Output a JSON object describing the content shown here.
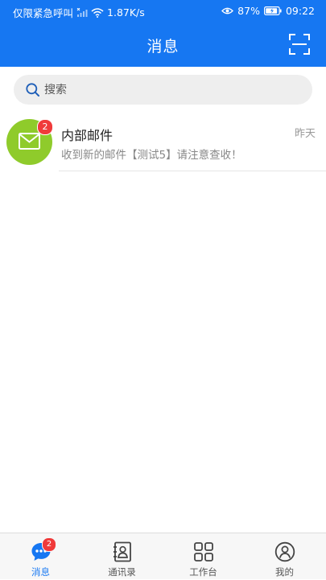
{
  "status_bar": {
    "carrier": "仅限紧急呼叫",
    "speed": "1.87K/s",
    "battery": "87%",
    "time": "09:22"
  },
  "header": {
    "title": "消息",
    "scan_icon": "scan-icon"
  },
  "search": {
    "placeholder": "搜索",
    "value": ""
  },
  "messages": [
    {
      "title": "内部邮件",
      "time": "昨天",
      "preview": "收到新的邮件【测试5】请注意查收！",
      "badge": "2",
      "icon": "mail-icon",
      "avatar_color": "#8fcb2b"
    }
  ],
  "tabs": [
    {
      "label": "消息",
      "icon": "chat-icon",
      "badge": "2",
      "active": true
    },
    {
      "label": "通讯录",
      "icon": "contacts-icon"
    },
    {
      "label": "工作台",
      "icon": "grid-icon"
    },
    {
      "label": "我的",
      "icon": "user-icon"
    }
  ],
  "colors": {
    "primary": "#1677f2",
    "badge": "#f03a3a"
  }
}
